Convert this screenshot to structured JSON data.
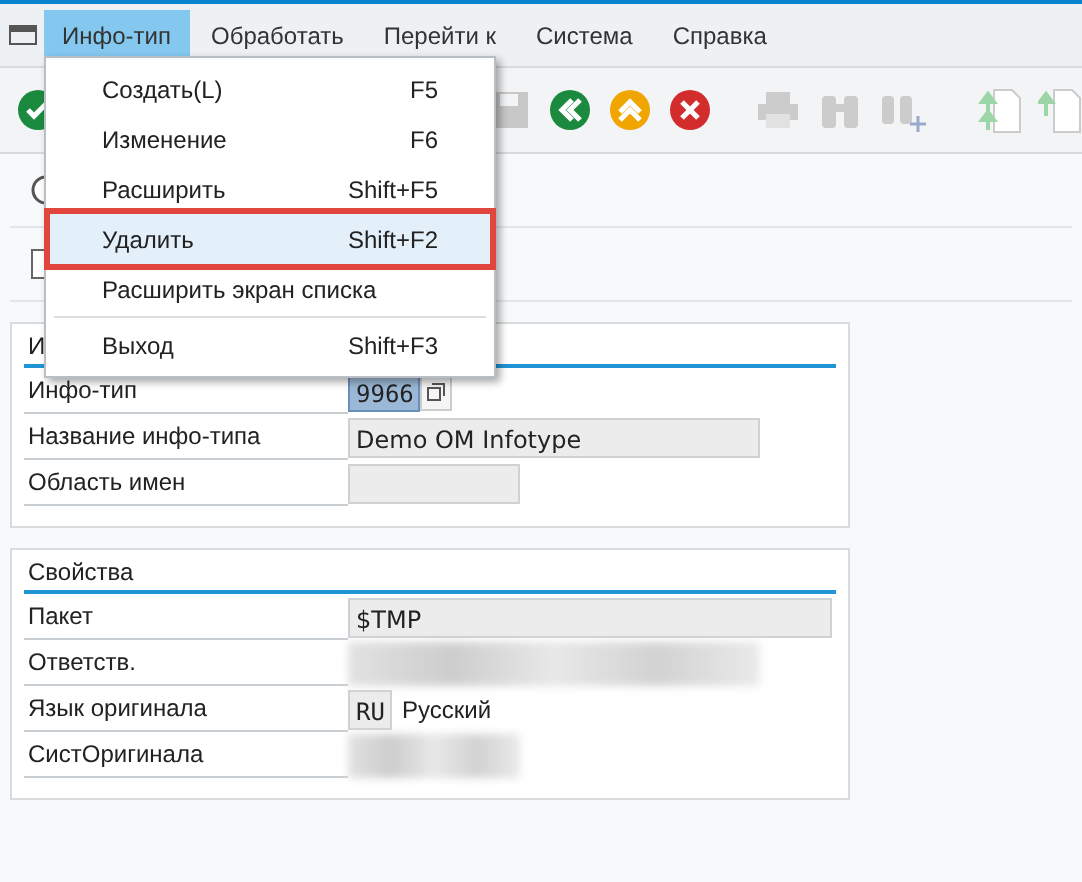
{
  "menubar": [
    {
      "label": "Инфо-тип",
      "selected": true
    },
    {
      "label": "Обработать",
      "selected": false
    },
    {
      "label": "Перейти к",
      "selected": false
    },
    {
      "label": "Система",
      "selected": false
    },
    {
      "label": "Справка",
      "selected": false
    }
  ],
  "menu": {
    "items": [
      {
        "label": "Создать(L)",
        "shortcut": "F5",
        "selected": false,
        "divider_before": false
      },
      {
        "label": "Изменение",
        "shortcut": "F6",
        "selected": false,
        "divider_before": false
      },
      {
        "label": "Расширить",
        "shortcut": "Shift+F5",
        "selected": false,
        "divider_before": false
      },
      {
        "label": "Удалить",
        "shortcut": "Shift+F2",
        "selected": true,
        "divider_before": false
      },
      {
        "label": "Расширить экран списка",
        "selected": false,
        "divider_before": false
      },
      {
        "label": "Выход",
        "shortcut": "Shift+F3",
        "selected": false,
        "divider_before": true
      }
    ]
  },
  "options": [
    {
      "kind": "radio",
      "checked": false
    },
    {
      "kind": "checkbox",
      "checked": false
    }
  ],
  "groups": [
    {
      "title": "И",
      "fields": [
        {
          "label": "Инфо-тип",
          "value": "9966",
          "kind": "input"
        },
        {
          "label": "Название инфо-типа",
          "value": "Demo OM Infotype",
          "kind": "readonly"
        },
        {
          "label": "Область имен",
          "kind": "readonly"
        }
      ]
    },
    {
      "title": "Свойства",
      "fields": [
        {
          "label": "Пакет",
          "value": "$TMP",
          "kind": "readonly"
        },
        {
          "label": "Ответств.",
          "kind": "redacted"
        },
        {
          "label": "Язык оригинала",
          "value": "RU",
          "extra": "Русский",
          "kind": "language"
        },
        {
          "label": "СистОригинала",
          "kind": "redacted"
        }
      ]
    }
  ]
}
